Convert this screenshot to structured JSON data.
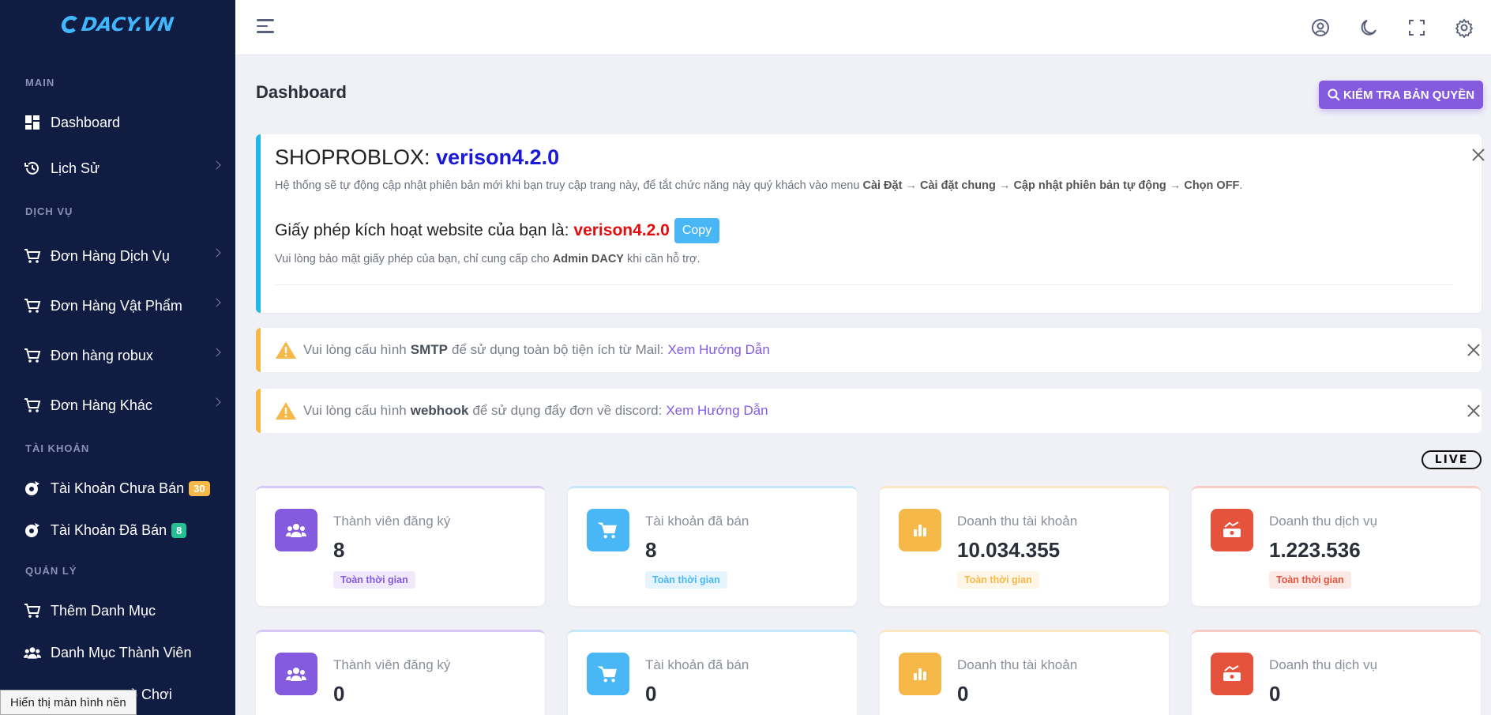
{
  "app": {
    "logo_text": "DACY.VN"
  },
  "sidebar": {
    "sections": [
      "MAIN",
      "DỊCH VỤ",
      "TÀI KHOẢN",
      "QUẢN LÝ"
    ],
    "items": [
      {
        "label": "Dashboard",
        "icon": "dashboard-icon"
      },
      {
        "label": "Lịch Sử",
        "icon": "history-icon"
      },
      {
        "label": "Đơn Hàng Dịch Vụ",
        "icon": "cart-icon"
      },
      {
        "label": "Đơn Hàng Vật Phẩm",
        "icon": "cart-icon"
      },
      {
        "label": "Đơn hàng robux",
        "icon": "cart-icon"
      },
      {
        "label": "Đơn Hàng Khác",
        "icon": "cart-icon"
      },
      {
        "label": "Tài Khoản Chưa Bán",
        "icon": "account-icon",
        "badge": "30"
      },
      {
        "label": "Tài Khoản Đã Bán",
        "icon": "account-icon",
        "badge": "8"
      },
      {
        "label": "Thêm Danh Mục",
        "icon": "cart-icon"
      },
      {
        "label": "Danh Mục Thành Viên",
        "icon": "users-icon"
      },
      {
        "label": "ò Chơi",
        "icon": "game-icon"
      }
    ],
    "tooltip": "Hiển thị màn hình nền"
  },
  "header": {
    "page_title": "Dashboard",
    "check_license_label": "KIỂM TRA BẢN QUYỀN"
  },
  "info_card": {
    "title_prefix": "SHOPROBLOX:",
    "version": "verison4.2.0",
    "update_text": "Hệ thống sẽ tự động cập nhật phiên bản mới khi bạn truy cập trang này, để tắt chức năng này quý khách vào menu",
    "path_1": "Cài Đặt",
    "path_2": "Cài đặt chung",
    "path_3": "Cập nhật phiên bản tự động",
    "path_4": "Chọn OFF",
    "license_label": "Giấy phép kích hoạt website của bạn là:",
    "license_value": "verison4.2.0",
    "copy_label": "Copy",
    "note_prefix": "Vui lòng bảo mật giấy phép của bạn, chỉ cung cấp cho",
    "note_bold": "Admin DACY",
    "note_suffix": "khi cần hỗ trợ."
  },
  "alerts": [
    {
      "prefix": "Vui lòng cấu hình",
      "bold": "SMTP",
      "suffix": "để sử dụng toàn bộ tiện ích từ Mail:",
      "link": "Xem Hướng Dẫn"
    },
    {
      "prefix": "Vui lòng cấu hình",
      "bold": "webhook",
      "suffix": "để sử dụng đẩy đơn về discord:",
      "link": "Xem Hướng Dẫn"
    }
  ],
  "live_label": "LIVE",
  "stats_row1": [
    {
      "label": "Thành viên đăng ký",
      "value": "8",
      "tag": "Toàn thời gian",
      "color": "#845adf",
      "icon": "users-icon"
    },
    {
      "label": "Tài khoản đã bán",
      "value": "8",
      "tag": "Toàn thời gian",
      "color": "#49b6f5",
      "icon": "cart-icon"
    },
    {
      "label": "Doanh thu tài khoản",
      "value": "10.034.355",
      "tag": "Toàn thời gian",
      "color": "#f5b849",
      "icon": "bar-chart-icon"
    },
    {
      "label": "Doanh thu dịch vụ",
      "value": "1.223.536",
      "tag": "Toàn thời gian",
      "color": "#e6533c",
      "icon": "money-icon"
    }
  ],
  "stats_row2": [
    {
      "label": "Thành viên đăng ký",
      "value": "0",
      "color": "#845adf",
      "icon": "users-icon"
    },
    {
      "label": "Tài khoản đã bán",
      "value": "0",
      "color": "#49b6f5",
      "icon": "cart-icon"
    },
    {
      "label": "Doanh thu tài khoản",
      "value": "0",
      "color": "#f5b849",
      "icon": "bar-chart-icon"
    },
    {
      "label": "Doanh thu dịch vụ",
      "value": "0",
      "color": "#e6533c",
      "icon": "money-icon"
    }
  ]
}
